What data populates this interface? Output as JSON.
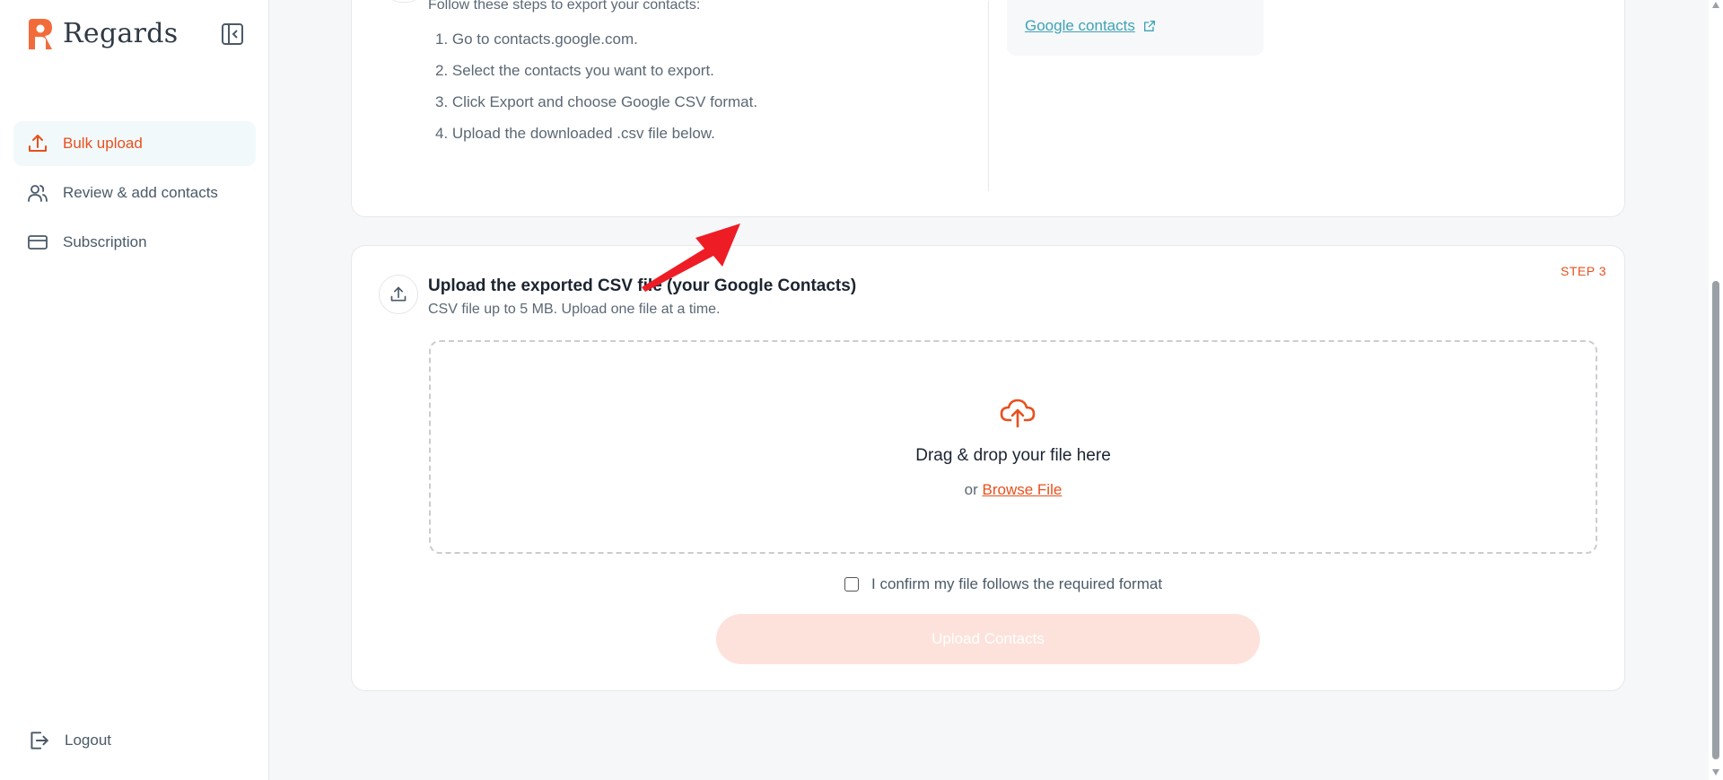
{
  "brand": {
    "name": "Regards",
    "accent": "#e8501d"
  },
  "sidebar": {
    "items": [
      {
        "label": "Bulk upload",
        "icon": "upload-icon",
        "active": true
      },
      {
        "label": "Review & add contacts",
        "icon": "users-icon",
        "active": false
      },
      {
        "label": "Subscription",
        "icon": "credit-card-icon",
        "active": false
      }
    ],
    "logout_label": "Logout"
  },
  "export_steps": {
    "intro": "Follow these steps to export your contacts:",
    "steps": [
      "1. Go to contacts.google.com.",
      "2. Select the contacts you want to export.",
      "3. Click Export and choose Google CSV format.",
      "4. Upload the downloaded .csv file below."
    ],
    "link_label": "Google contacts"
  },
  "upload": {
    "title": "Upload the exported CSV file (your Google Contacts)",
    "subtitle": "CSV file up to 5 MB. Upload one file at a time.",
    "step_label": "STEP 3",
    "drop_title": "Drag & drop your file here",
    "drop_or": "or",
    "browse_label": "Browse File",
    "confirm_label": "I confirm my file follows the required format",
    "button_label": "Upload Contacts"
  }
}
